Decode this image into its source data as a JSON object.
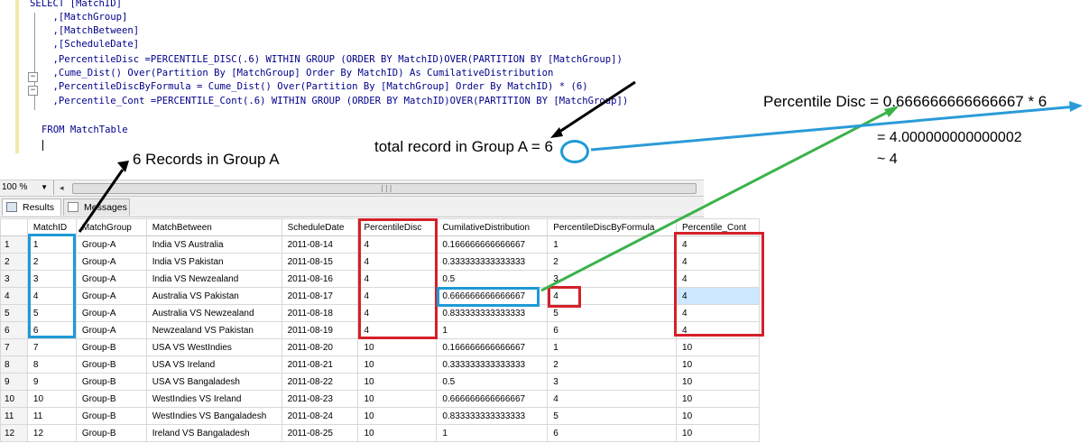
{
  "editor": {
    "code_lines": [
      "SELECT [MatchID]",
      "    ,[MatchGroup]",
      "    ,[MatchBetween]",
      "    ,[ScheduleDate]",
      "    ,PercentileDisc =PERCENTILE_DISC(.6) WITHIN GROUP (ORDER BY MatchID)OVER(PARTITION BY [MatchGroup])",
      "    ,Cume_Dist() Over(Partition By [MatchGroup] Order By MatchID) As CumilativeDistribution",
      "    ,PercentileDiscByFormula = Cume_Dist() Over(Partition By [MatchGroup] Order By MatchID) * (6)",
      "    ,Percentile_Cont =PERCENTILE_Cont(.6) WITHIN GROUP (ORDER BY MatchID)OVER(PARTITION BY [MatchGroup])",
      "",
      "FROM MatchTable"
    ]
  },
  "zoom": {
    "value": "100 %"
  },
  "tabs": {
    "results": "Results",
    "messages": "Messages"
  },
  "grid": {
    "columns": [
      "MatchID",
      "MatchGroup",
      "MatchBetween",
      "ScheduleDate",
      "PercentileDisc",
      "CumilativeDistribution",
      "PercentileDiscByFormula",
      "Percentile_Cont"
    ],
    "rows": [
      [
        "1",
        "1",
        "Group-A",
        "India VS Australia",
        "2011-08-14",
        "4",
        "0.166666666666667",
        "1",
        "4"
      ],
      [
        "2",
        "2",
        "Group-A",
        "India VS Pakistan",
        "2011-08-15",
        "4",
        "0.333333333333333",
        "2",
        "4"
      ],
      [
        "3",
        "3",
        "Group-A",
        "India VS Newzealand",
        "2011-08-16",
        "4",
        "0.5",
        "3",
        "4"
      ],
      [
        "4",
        "4",
        "Group-A",
        "Australia VS Pakistan",
        "2011-08-17",
        "4",
        "0.666666666666667",
        "4",
        "4"
      ],
      [
        "5",
        "5",
        "Group-A",
        "Australia VS Newzealand",
        "2011-08-18",
        "4",
        "0.833333333333333",
        "5",
        "4"
      ],
      [
        "6",
        "6",
        "Group-A",
        "Newzealand VS Pakistan",
        "2011-08-19",
        "4",
        "1",
        "6",
        "4"
      ],
      [
        "7",
        "7",
        "Group-B",
        "USA VS WestIndies",
        "2011-08-20",
        "10",
        "0.166666666666667",
        "1",
        "10"
      ],
      [
        "8",
        "8",
        "Group-B",
        "USA VS Ireland",
        "2011-08-21",
        "10",
        "0.333333333333333",
        "2",
        "10"
      ],
      [
        "9",
        "9",
        "Group-B",
        "USA VS Bangaladesh",
        "2011-08-22",
        "10",
        "0.5",
        "3",
        "10"
      ],
      [
        "10",
        "10",
        "Group-B",
        "WestIndies VS Ireland",
        "2011-08-23",
        "10",
        "0.666666666666667",
        "4",
        "10"
      ],
      [
        "11",
        "11",
        "Group-B",
        "WestIndies VS Bangaladesh",
        "2011-08-24",
        "10",
        "0.833333333333333",
        "5",
        "10"
      ],
      [
        "12",
        "12",
        "Group-B",
        "Ireland VS Bangaladesh",
        "2011-08-25",
        "10",
        "1",
        "6",
        "10"
      ]
    ]
  },
  "annotations": {
    "records_note": "6 Records in Group A",
    "total_note": "total record in Group A = 6",
    "formula_line1": "Percentile Disc = 0.666666666666667 * 6",
    "formula_line2": "= 4.000000000000002",
    "formula_line3": "~ 4"
  },
  "colors": {
    "box_red": "#d42028",
    "box_blue": "#1e9ad6",
    "arrow_green": "#3bb34a",
    "arrow_blue": "#2a9bd8",
    "arrow_black": "#000000"
  }
}
